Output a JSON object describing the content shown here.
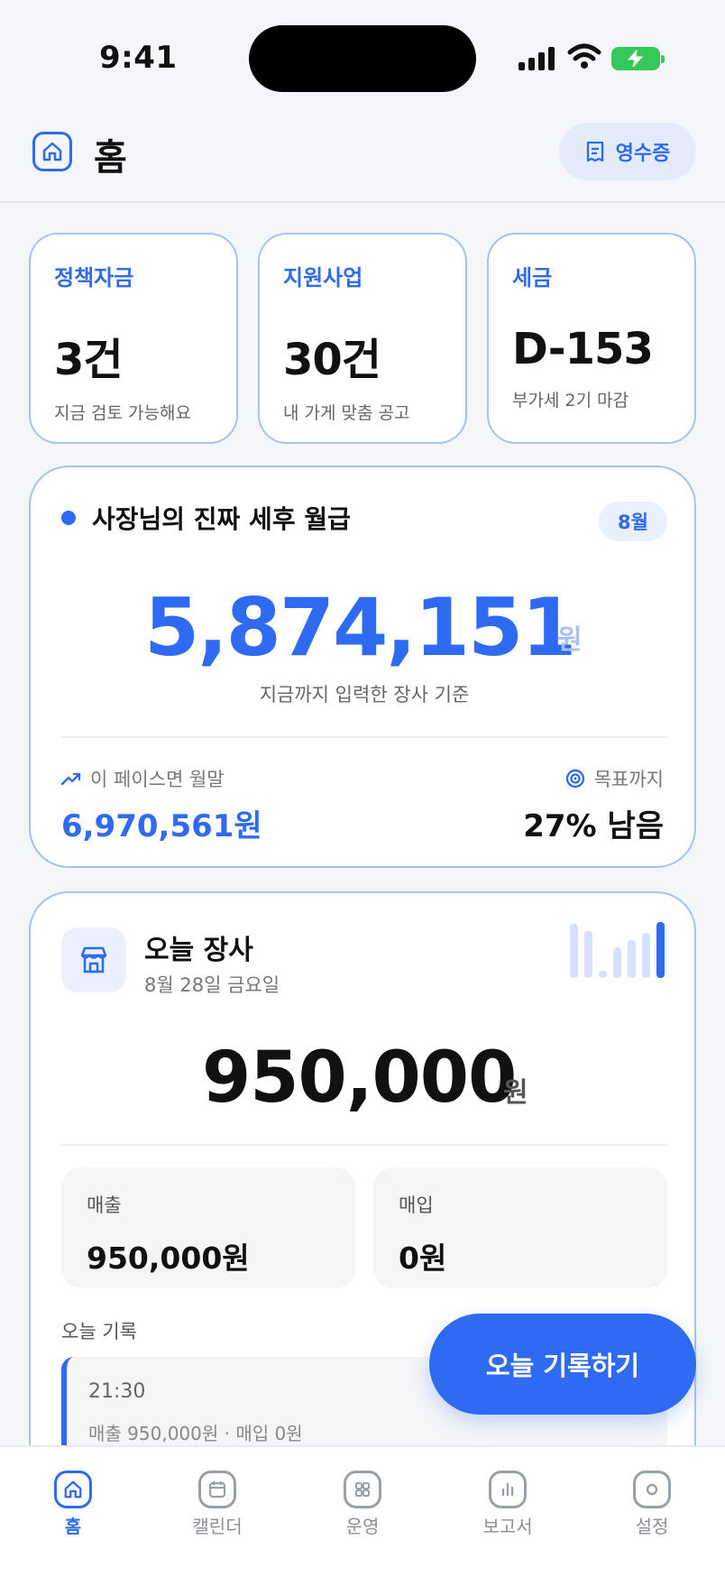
{
  "status": {
    "time": "9:41"
  },
  "header": {
    "title": "홈",
    "receipt_label": "영수증"
  },
  "stats": [
    {
      "label": "정책자금",
      "value": "3건",
      "sub": "지금 검토 가능해요"
    },
    {
      "label": "지원사업",
      "value": "30건",
      "sub": "내 가게 맞춤 공고"
    },
    {
      "label": "세금",
      "value": "D-153",
      "sub": "부가세 2기 마감"
    }
  ],
  "salary": {
    "title": "사장님의 진짜 세후 월급",
    "month": "8월",
    "amount": "5,874,151",
    "unit": "원",
    "basis": "지금까지 입력한 장사 기준",
    "pace_label": "이 페이스면 월말",
    "pace_value": "6,970,561원",
    "goal_label": "목표까지",
    "goal_value": "27% 남음"
  },
  "today": {
    "title": "오늘 장사",
    "date": "8월 28일 금요일",
    "amount": "950,000",
    "unit": "원",
    "sales_label": "매출",
    "sales_value": "950,000원",
    "purchase_label": "매입",
    "purchase_value": "0원",
    "records_label": "오늘 기록",
    "records": [
      {
        "time": "21:30",
        "desc": "매출 950,000원 · 매입 0원"
      }
    ]
  },
  "fab_label": "오늘 기록하기",
  "tabs": [
    {
      "label": "홈",
      "icon": "home-icon",
      "active": true
    },
    {
      "label": "캘린더",
      "icon": "calendar-icon",
      "active": false
    },
    {
      "label": "운영",
      "icon": "grid-icon",
      "active": false
    },
    {
      "label": "보고서",
      "icon": "chart-icon",
      "active": false
    },
    {
      "label": "설정",
      "icon": "settings-icon",
      "active": false
    }
  ],
  "colors": {
    "accent": "#2f6bf2",
    "accent_light": "#eaf0fd",
    "card_border": "#a7c2f3"
  }
}
